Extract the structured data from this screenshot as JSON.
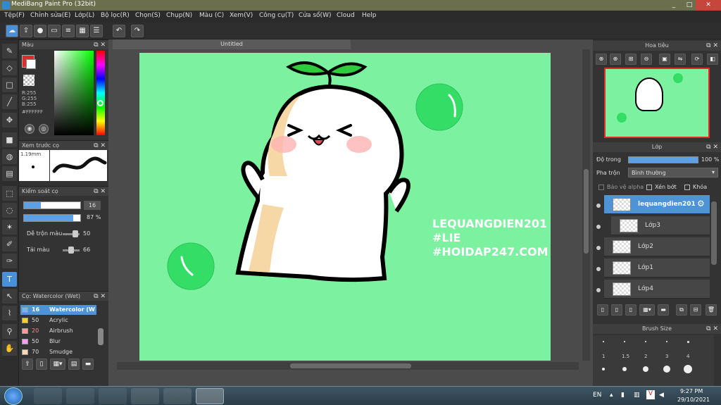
{
  "window": {
    "title": "MediBang Paint Pro (32bit)",
    "minimize": "_",
    "maximize": "□",
    "close": "✕"
  },
  "menu": [
    "Tệp(F)",
    "Chỉnh sửa(E)",
    "Lớp(L)",
    "Bộ lọc(R)",
    "Chọn(S)",
    "Chụp(N)",
    "Màu (C)",
    "Xem(V)",
    "Công cụ(T)",
    "Cửa sổ(W)",
    "Cloud",
    "Help"
  ],
  "toolbar": {
    "undo_icon": "↶",
    "redo_icon": "↷"
  },
  "color_panel": {
    "title": "Màu",
    "r": "R:255",
    "g": "G:255",
    "b": "B:255",
    "hex": "#FFFFFF"
  },
  "brush_preview": {
    "title": "Xem trước cọ",
    "size": "1.19mm"
  },
  "brush_control": {
    "title": "Kiểm soát cọ",
    "size_value": "16",
    "opacity_value": "87 %",
    "opacity_fraction": 0.87,
    "blend_label": "Dễ trộn màu",
    "blend_value": "50",
    "resample_label": "Tải màu",
    "resample_value": "66"
  },
  "brush_list": {
    "title": "Cọ: Watercolor (Wet)",
    "items": [
      {
        "size": "16",
        "name": "Watercolor (W",
        "color": "#6fb6f0"
      },
      {
        "size": "50",
        "name": "Acrylic",
        "color": "#f2d21b"
      },
      {
        "size": "20",
        "name": "Airbrush",
        "color": "#ff9a9a"
      },
      {
        "size": "50",
        "name": "Blur",
        "color": "#ff9cf0"
      },
      {
        "size": "70",
        "name": "Smudge",
        "color": "#ffd9b5"
      }
    ]
  },
  "document": {
    "tab_title": "Untitled"
  },
  "artwork": {
    "line1": "LEQUANGDIEN201",
    "line2": "#LIE",
    "line3": "#HOIDAP247.COM"
  },
  "navigator": {
    "title": "Hoa tiêu"
  },
  "layer_panel": {
    "title": "Lớp",
    "opacity_label": "Độ trong",
    "opacity_value": "100 %",
    "opacity_fraction": 1.0,
    "blend_label": "Pha trộn",
    "blend_value": "Bình thường",
    "protect_alpha": "Bảo vệ alpha",
    "clipping": "Xén bớt",
    "lock": "Khóa",
    "layers": [
      "lequangdien201",
      "Lớp3",
      "Lớp2",
      "Lớp1",
      "Lớp4"
    ]
  },
  "brush_size_panel": {
    "title": "Brush Size",
    "labels": [
      "1",
      "1.5",
      "2",
      "3",
      "4"
    ]
  },
  "taskbar": {
    "language": "EN",
    "time": "9:27 PM",
    "date": "29/10/2021"
  }
}
